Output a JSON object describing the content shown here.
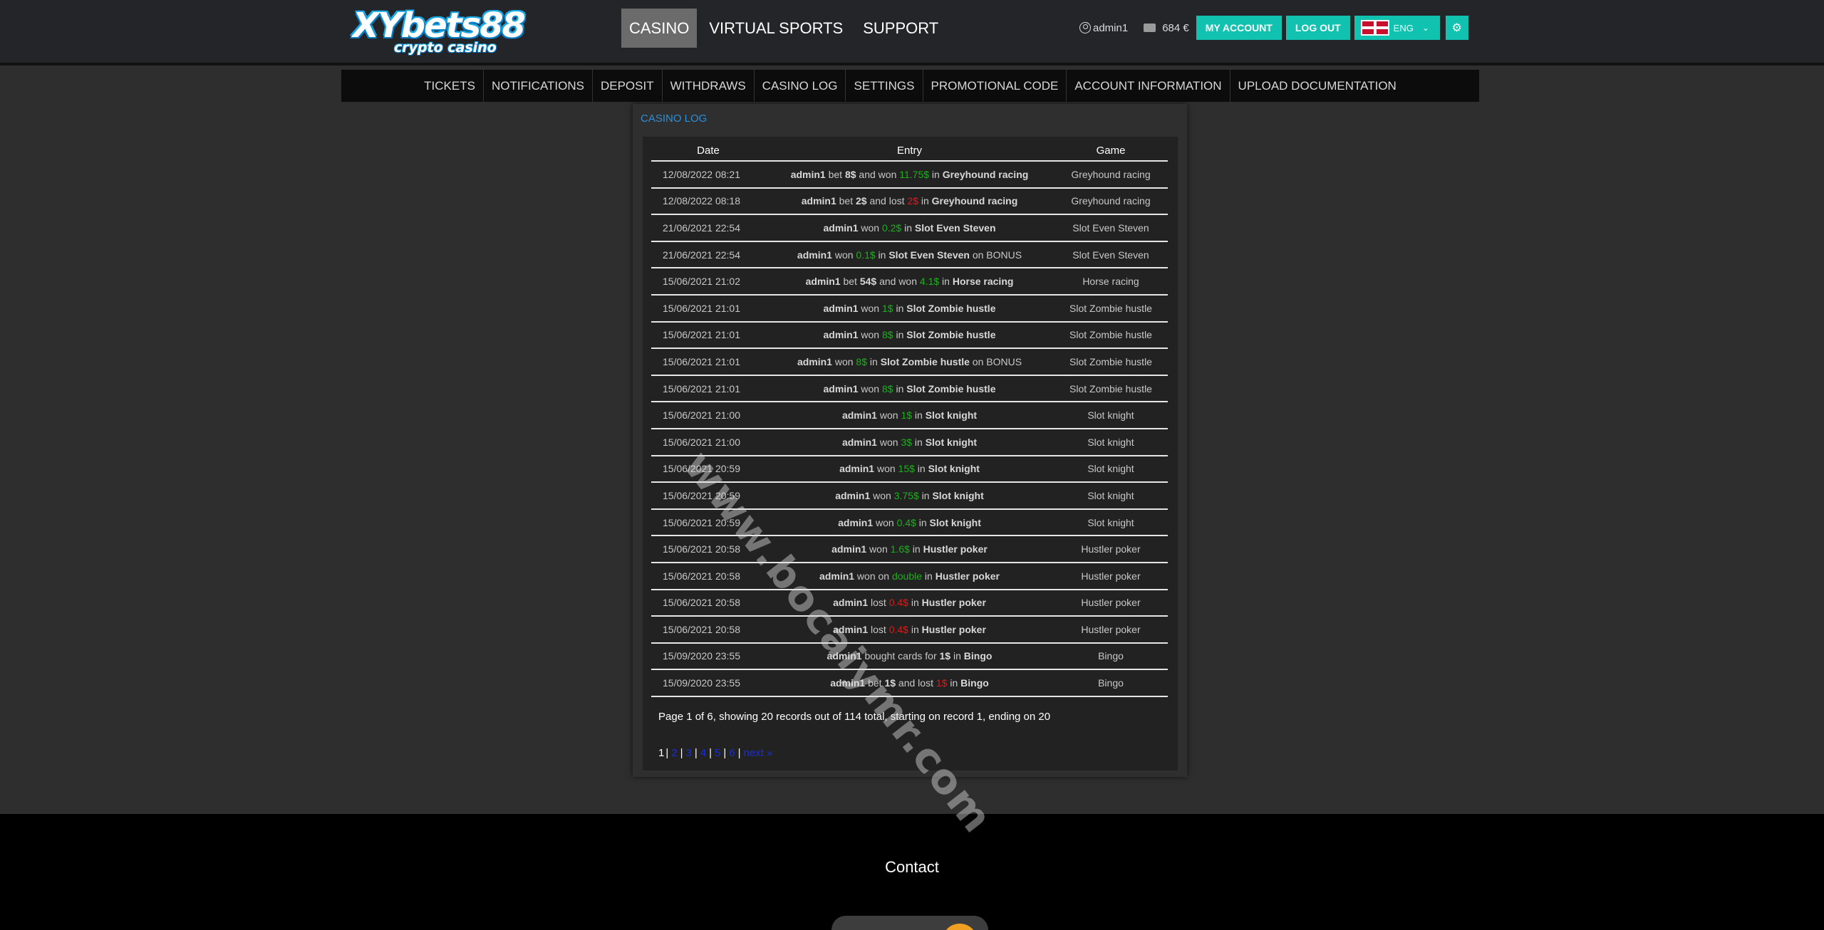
{
  "header": {
    "logo_main": "XYbets88",
    "logo_sub": "crypto casino",
    "nav": [
      "CASINO",
      "VIRTUAL SPORTS",
      "SUPPORT"
    ],
    "username": "admin1",
    "balance": "684 €",
    "my_account": "MY ACCOUNT",
    "logout": "LOG OUT",
    "language": "ENG",
    "accent_color": "#12c2b0"
  },
  "subnav": [
    "TICKETS",
    "NOTIFICATIONS",
    "DEPOSIT",
    "WITHDRAWS",
    "CASINO LOG",
    "SETTINGS",
    "PROMOTIONAL CODE",
    "ACCOUNT INFORMATION",
    "UPLOAD DOCUMENTATION"
  ],
  "casino_log": {
    "title": "CASINO LOG",
    "columns": [
      "Date",
      "Entry",
      "Game"
    ],
    "rows": [
      {
        "date": "12/08/2022 08:21",
        "entry": [
          {
            "t": "admin1",
            "s": "b"
          },
          {
            "t": " bet "
          },
          {
            "t": "8$",
            "s": "b"
          },
          {
            "t": " and won "
          },
          {
            "t": "11.75$",
            "s": "win"
          },
          {
            "t": " in "
          },
          {
            "t": "Greyhound racing",
            "s": "b"
          }
        ],
        "game": "Greyhound racing"
      },
      {
        "date": "12/08/2022 08:18",
        "entry": [
          {
            "t": "admin1",
            "s": "b"
          },
          {
            "t": " bet "
          },
          {
            "t": "2$",
            "s": "b"
          },
          {
            "t": " and lost "
          },
          {
            "t": "2$",
            "s": "loss"
          },
          {
            "t": " in "
          },
          {
            "t": "Greyhound racing",
            "s": "b"
          }
        ],
        "game": "Greyhound racing"
      },
      {
        "date": "21/06/2021 22:54",
        "entry": [
          {
            "t": "admin1",
            "s": "b"
          },
          {
            "t": " won "
          },
          {
            "t": "0.2$",
            "s": "win"
          },
          {
            "t": " in "
          },
          {
            "t": "Slot Even Steven",
            "s": "b"
          }
        ],
        "game": "Slot Even Steven"
      },
      {
        "date": "21/06/2021 22:54",
        "entry": [
          {
            "t": "admin1",
            "s": "b"
          },
          {
            "t": " won "
          },
          {
            "t": "0.1$",
            "s": "win"
          },
          {
            "t": " in "
          },
          {
            "t": "Slot Even Steven",
            "s": "b"
          },
          {
            "t": " on BONUS"
          }
        ],
        "game": "Slot Even Steven"
      },
      {
        "date": "15/06/2021 21:02",
        "entry": [
          {
            "t": "admin1",
            "s": "b"
          },
          {
            "t": " bet "
          },
          {
            "t": "54$",
            "s": "b"
          },
          {
            "t": " and won "
          },
          {
            "t": "4.1$",
            "s": "win"
          },
          {
            "t": " in "
          },
          {
            "t": "Horse racing",
            "s": "b"
          }
        ],
        "game": "Horse racing"
      },
      {
        "date": "15/06/2021 21:01",
        "entry": [
          {
            "t": "admin1",
            "s": "b"
          },
          {
            "t": " won "
          },
          {
            "t": "1$",
            "s": "win"
          },
          {
            "t": " in "
          },
          {
            "t": "Slot Zombie hustle",
            "s": "b"
          }
        ],
        "game": "Slot Zombie hustle"
      },
      {
        "date": "15/06/2021 21:01",
        "entry": [
          {
            "t": "admin1",
            "s": "b"
          },
          {
            "t": " won "
          },
          {
            "t": "8$",
            "s": "win"
          },
          {
            "t": " in "
          },
          {
            "t": "Slot Zombie hustle",
            "s": "b"
          }
        ],
        "game": "Slot Zombie hustle"
      },
      {
        "date": "15/06/2021 21:01",
        "entry": [
          {
            "t": "admin1",
            "s": "b"
          },
          {
            "t": " won "
          },
          {
            "t": "8$",
            "s": "win"
          },
          {
            "t": " in "
          },
          {
            "t": "Slot Zombie hustle",
            "s": "b"
          },
          {
            "t": " on BONUS"
          }
        ],
        "game": "Slot Zombie hustle"
      },
      {
        "date": "15/06/2021 21:01",
        "entry": [
          {
            "t": "admin1",
            "s": "b"
          },
          {
            "t": " won "
          },
          {
            "t": "8$",
            "s": "win"
          },
          {
            "t": " in "
          },
          {
            "t": "Slot Zombie hustle",
            "s": "b"
          }
        ],
        "game": "Slot Zombie hustle"
      },
      {
        "date": "15/06/2021 21:00",
        "entry": [
          {
            "t": "admin1",
            "s": "b"
          },
          {
            "t": " won "
          },
          {
            "t": "1$",
            "s": "win"
          },
          {
            "t": " in "
          },
          {
            "t": "Slot knight",
            "s": "b"
          }
        ],
        "game": "Slot knight"
      },
      {
        "date": "15/06/2021 21:00",
        "entry": [
          {
            "t": "admin1",
            "s": "b"
          },
          {
            "t": " won "
          },
          {
            "t": "3$",
            "s": "win"
          },
          {
            "t": " in "
          },
          {
            "t": "Slot knight",
            "s": "b"
          }
        ],
        "game": "Slot knight"
      },
      {
        "date": "15/06/2021 20:59",
        "entry": [
          {
            "t": "admin1",
            "s": "b"
          },
          {
            "t": " won "
          },
          {
            "t": "15$",
            "s": "win"
          },
          {
            "t": " in "
          },
          {
            "t": "Slot knight",
            "s": "b"
          }
        ],
        "game": "Slot knight"
      },
      {
        "date": "15/06/2021 20:59",
        "entry": [
          {
            "t": "admin1",
            "s": "b"
          },
          {
            "t": " won "
          },
          {
            "t": "3.75$",
            "s": "win"
          },
          {
            "t": " in "
          },
          {
            "t": "Slot knight",
            "s": "b"
          }
        ],
        "game": "Slot knight"
      },
      {
        "date": "15/06/2021 20:59",
        "entry": [
          {
            "t": "admin1",
            "s": "b"
          },
          {
            "t": " won "
          },
          {
            "t": "0.4$",
            "s": "win"
          },
          {
            "t": " in "
          },
          {
            "t": "Slot knight",
            "s": "b"
          }
        ],
        "game": "Slot knight"
      },
      {
        "date": "15/06/2021 20:58",
        "entry": [
          {
            "t": "admin1",
            "s": "b"
          },
          {
            "t": " won "
          },
          {
            "t": "1.6$",
            "s": "win"
          },
          {
            "t": " in "
          },
          {
            "t": "Hustler poker",
            "s": "b"
          }
        ],
        "game": "Hustler poker"
      },
      {
        "date": "15/06/2021 20:58",
        "entry": [
          {
            "t": "admin1",
            "s": "b"
          },
          {
            "t": " won on "
          },
          {
            "t": "double",
            "s": "win"
          },
          {
            "t": " in "
          },
          {
            "t": "Hustler poker",
            "s": "b"
          }
        ],
        "game": "Hustler poker"
      },
      {
        "date": "15/06/2021 20:58",
        "entry": [
          {
            "t": "admin1",
            "s": "b"
          },
          {
            "t": " lost "
          },
          {
            "t": "0.4$",
            "s": "loss"
          },
          {
            "t": " in "
          },
          {
            "t": "Hustler poker",
            "s": "b"
          }
        ],
        "game": "Hustler poker"
      },
      {
        "date": "15/06/2021 20:58",
        "entry": [
          {
            "t": "admin1",
            "s": "b"
          },
          {
            "t": " lost "
          },
          {
            "t": "0.4$",
            "s": "loss"
          },
          {
            "t": " in "
          },
          {
            "t": "Hustler poker",
            "s": "b"
          }
        ],
        "game": "Hustler poker"
      },
      {
        "date": "15/09/2020 23:55",
        "entry": [
          {
            "t": "admin1",
            "s": "b"
          },
          {
            "t": " bought cards for "
          },
          {
            "t": "1$",
            "s": "b"
          },
          {
            "t": " in "
          },
          {
            "t": "Bingo",
            "s": "b"
          }
        ],
        "game": "Bingo"
      },
      {
        "date": "15/09/2020 23:55",
        "entry": [
          {
            "t": "admin1",
            "s": "b"
          },
          {
            "t": " bet "
          },
          {
            "t": "1$",
            "s": "b"
          },
          {
            "t": " and lost "
          },
          {
            "t": "1$",
            "s": "loss"
          },
          {
            "t": " in "
          },
          {
            "t": "Bingo",
            "s": "b"
          }
        ],
        "game": "Bingo"
      }
    ],
    "summary": "Page 1 of 6, showing 20 records out of 114 total, starting on record 1, ending on 20",
    "pager": {
      "current": "1",
      "links": [
        "2",
        "3",
        "4",
        "5",
        "6",
        "next »"
      ]
    }
  },
  "footer": {
    "contact": "Contact"
  },
  "watermark": "www.bocaiymr.com"
}
